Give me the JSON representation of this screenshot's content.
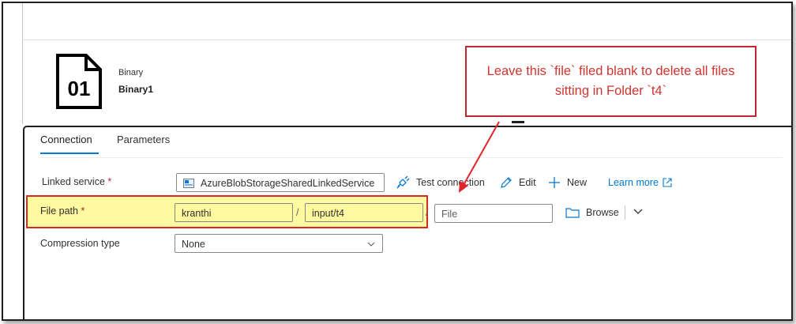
{
  "dataset": {
    "icon_text": "01",
    "icon": "binary-file-icon",
    "type": "Binary",
    "name": "Binary1"
  },
  "tabs": [
    {
      "label": "Connection",
      "active": true
    },
    {
      "label": "Parameters",
      "active": false
    }
  ],
  "form": {
    "linked_service": {
      "label": "Linked service",
      "required_mark": "*",
      "value": "AzureBlobStorageSharedLinkedService",
      "icon": "storage-account-icon"
    },
    "linked_actions": {
      "test_connection": "Test connection",
      "edit": "Edit",
      "new": "New",
      "learn_more": "Learn more"
    },
    "file_path": {
      "label": "File path",
      "required_mark": "*",
      "container": "kranthi",
      "directory": "input/t4",
      "file_placeholder": "File",
      "separator": "/",
      "browse_label": "Browse"
    },
    "compression_type": {
      "label": "Compression type",
      "value": "None"
    }
  },
  "annotation": {
    "text": "Leave this `file` filed blank to delete all files sitting in Folder `t4`",
    "color": "#d1342f",
    "highlight_color": "#fff9a0"
  }
}
